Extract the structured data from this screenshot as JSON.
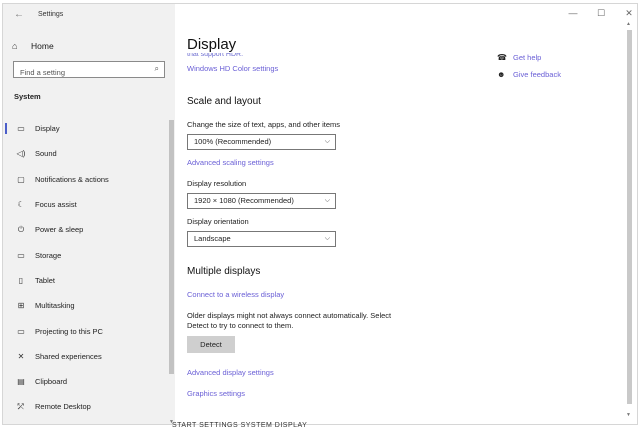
{
  "window": {
    "app_title": "Settings",
    "back_glyph": "←",
    "minimize_glyph": "—",
    "maximize_glyph": "☐",
    "close_glyph": "✕"
  },
  "sidebar": {
    "home_label": "Home",
    "home_icon": "⌂",
    "search_placeholder": "Find a setting",
    "search_icon": "⌕",
    "section_title": "System",
    "items": [
      {
        "label": "Display",
        "icon": "▭",
        "active": true
      },
      {
        "label": "Sound",
        "icon": "◁)"
      },
      {
        "label": "Notifications & actions",
        "icon": "▢"
      },
      {
        "label": "Focus assist",
        "icon": "☾"
      },
      {
        "label": "Power & sleep",
        "icon": "⏻"
      },
      {
        "label": "Storage",
        "icon": "▭"
      },
      {
        "label": "Tablet",
        "icon": "▯"
      },
      {
        "label": "Multitasking",
        "icon": "⊞"
      },
      {
        "label": "Projecting to this PC",
        "icon": "▭"
      },
      {
        "label": "Shared experiences",
        "icon": "✕"
      },
      {
        "label": "Clipboard",
        "icon": "▤"
      },
      {
        "label": "Remote Desktop",
        "icon": "⤱"
      }
    ]
  },
  "main": {
    "page_title": "Display",
    "cut_text": "that support HDR.",
    "hd_color_link": "Windows HD Color settings",
    "scale_heading": "Scale and layout",
    "scale_label": "Change the size of text, apps, and other items",
    "scale_value": "100% (Recommended)",
    "advanced_scaling_link": "Advanced scaling settings",
    "resolution_label": "Display resolution",
    "resolution_value": "1920 × 1080 (Recommended)",
    "orientation_label": "Display orientation",
    "orientation_value": "Landscape",
    "multiple_heading": "Multiple displays",
    "wireless_link": "Connect to a wireless display",
    "detect_paragraph": "Older displays might not always connect automatically. Select Detect to try to connect to them.",
    "detect_button": "Detect",
    "advanced_display_link": "Advanced display settings",
    "graphics_link": "Graphics settings",
    "chevron": "⌵"
  },
  "help": {
    "get_help": "Get help",
    "give_feedback": "Give feedback"
  },
  "bottom_text": "START SETTINGS SYSTEM DISPLAY",
  "colors": {
    "accent": "#6a5fd6",
    "active_bar": "#4b5ec9",
    "sidebar_bg": "#f1f1f1"
  }
}
